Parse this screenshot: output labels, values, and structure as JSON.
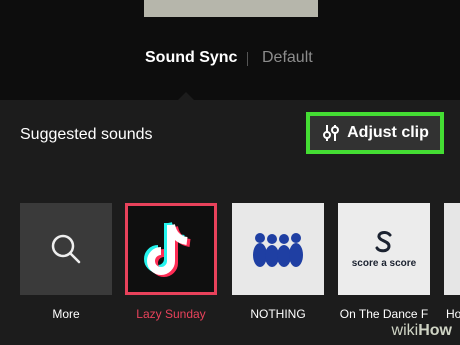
{
  "header": {
    "mode_active": "Sound Sync",
    "mode_default": "Default"
  },
  "panel": {
    "title": "Suggested sounds",
    "adjust_label": "Adjust clip",
    "sounds": [
      {
        "label": "More",
        "icon": "search-icon"
      },
      {
        "label": "Lazy Sunday",
        "icon": "tiktok-logo-icon",
        "selected": true
      },
      {
        "label": "NOTHING",
        "icon": "album-art-icon"
      },
      {
        "label": "On The Dance F",
        "icon": "score-a-score-logo",
        "art_text": "score a score"
      },
      {
        "label": "Hor",
        "icon": "album-art-icon"
      }
    ]
  },
  "watermark": {
    "wiki": "wiki",
    "how": "How"
  },
  "colors": {
    "highlight": "#44dd33",
    "selected": "#e8425b",
    "panel_bg": "#1c1c1c"
  }
}
